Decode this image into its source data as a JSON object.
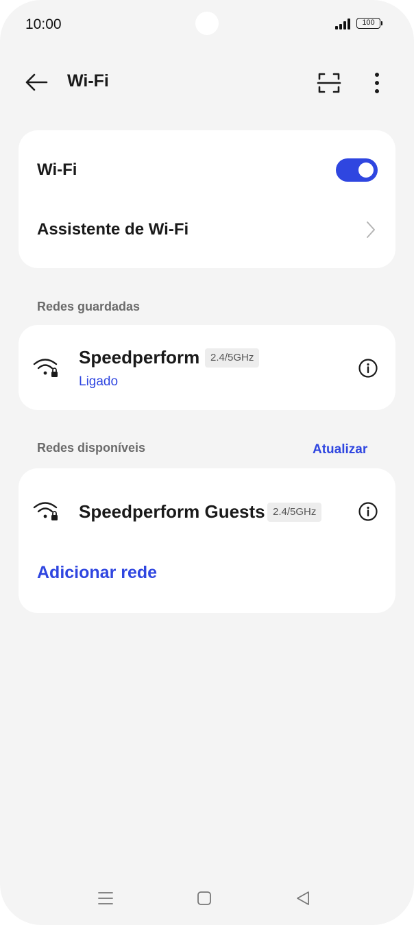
{
  "status_bar": {
    "time": "10:00",
    "battery": "100",
    "icons": [
      "signal-icon",
      "battery-icon"
    ]
  },
  "app_bar": {
    "title": "Wi-Fi",
    "icons": [
      "back-arrow-icon",
      "scan-qr-icon",
      "more-vertical-icon"
    ]
  },
  "settings": {
    "wifi_label": "Wi-Fi",
    "wifi_enabled": true,
    "assistant_label": "Assistente de Wi-Fi"
  },
  "saved_networks": {
    "header": "Redes guardadas",
    "items": [
      {
        "name": "Speedperform",
        "band": "2.4/5GHz",
        "status": "Ligado",
        "icon": "wifi-lock-icon"
      }
    ]
  },
  "available_networks": {
    "header": "Redes disponíveis",
    "refresh_label": "Atualizar",
    "items": [
      {
        "name": "Speedperform Guests",
        "band": "2.4/5GHz",
        "icon": "wifi-lock-icon"
      }
    ],
    "add_label": "Adicionar rede"
  },
  "nav_bar": {
    "icons": [
      "menu-icon",
      "home-icon",
      "back-icon"
    ]
  },
  "colors": {
    "accent": "#2f46e0",
    "background": "#f4f4f4",
    "card": "#ffffff"
  }
}
